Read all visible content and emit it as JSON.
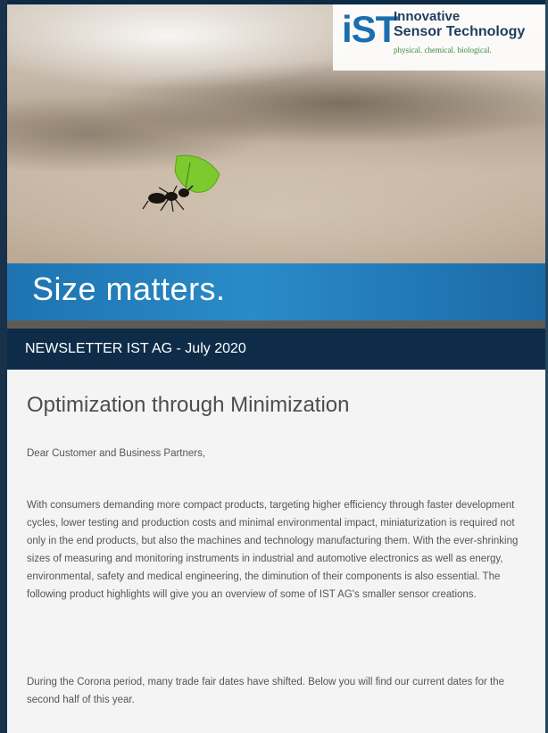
{
  "header": {
    "logo_mark": "iST",
    "logo_line1": "Innovative",
    "logo_line2": "Sensor Technology",
    "logo_tagline": "physical. chemical. biological."
  },
  "banner": {
    "title": "Size matters."
  },
  "newsletter": {
    "label": "NEWSLETTER IST AG - July 2020"
  },
  "article": {
    "headline": "Optimization through Minimization",
    "greeting": "Dear Customer and Business Partners,",
    "paragraph1": "With consumers demanding more compact products, targeting higher efficiency through faster development cycles, lower testing and production costs and minimal environmental impact, miniaturization is required not only in the end products, but also the machines and technology manufacturing them. With the ever-shrinking sizes of measuring and monitoring instruments in industrial and automotive electronics as well as energy, environmental, safety and medical engineering, the diminution of their components is also essential. The following product highlights will give you an overview of some of IST AG's smaller sensor creations.",
    "paragraph2": "During the Corona period, many trade fair dates have shifted. Below you will find our current dates for the second half of this year."
  },
  "colors": {
    "banner_blue": "#1e73b0",
    "navy": "#0e2c48",
    "logo_blue": "#1a6fb0",
    "tagline_green": "#3b8a3e"
  }
}
